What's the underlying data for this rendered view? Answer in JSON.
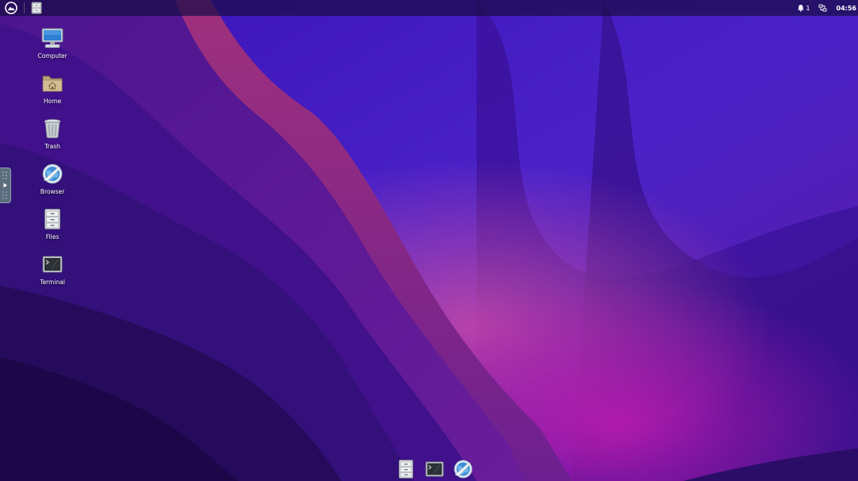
{
  "top_panel": {
    "notification_count": "1",
    "clock": "04:56"
  },
  "desktop_icons": [
    {
      "label": "Computer",
      "icon": "computer-icon"
    },
    {
      "label": "Home",
      "icon": "home-folder-icon"
    },
    {
      "label": "Trash",
      "icon": "trash-icon"
    },
    {
      "label": "Browser",
      "icon": "browser-icon"
    },
    {
      "label": "Files",
      "icon": "files-icon"
    },
    {
      "label": "Terminal",
      "icon": "terminal-icon"
    }
  ],
  "dock": {
    "items": [
      {
        "icon": "files-icon"
      },
      {
        "icon": "terminal-icon"
      },
      {
        "icon": "browser-icon"
      }
    ]
  },
  "colors": {
    "wallpaper_dark": "#1a0840",
    "wallpaper_mid": "#3f10a0",
    "wallpaper_magenta": "#b0208a",
    "panel": "#190c46"
  }
}
